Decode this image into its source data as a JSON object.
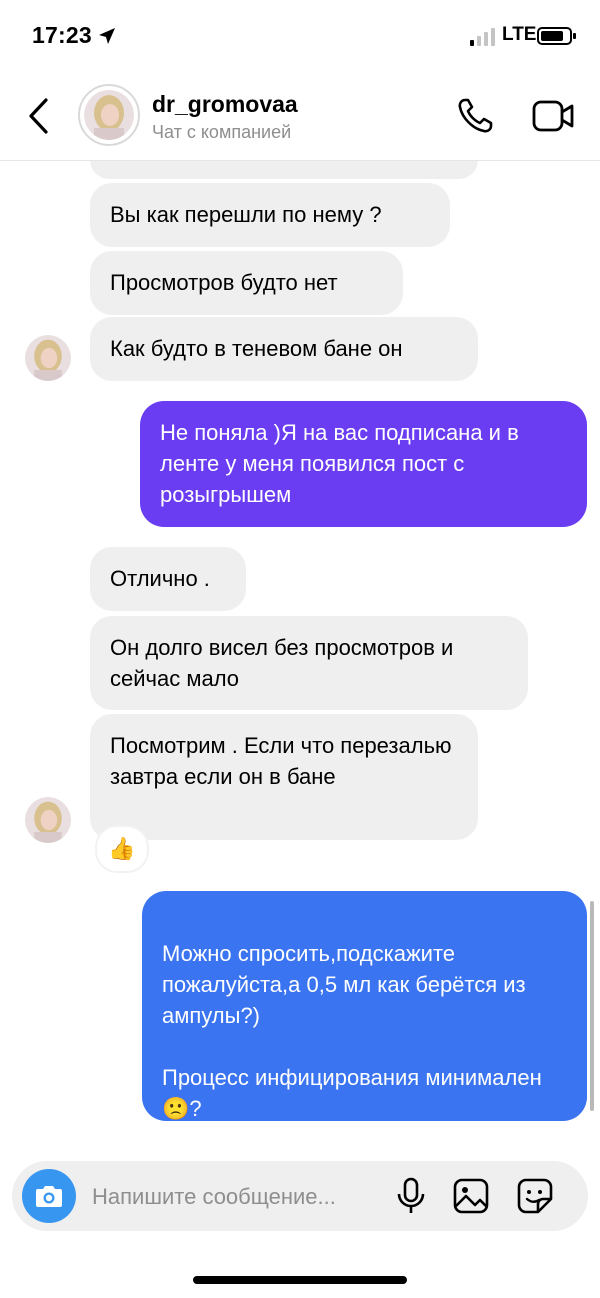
{
  "status_bar": {
    "time": "17:23",
    "network": "LTE"
  },
  "header": {
    "username": "dr_gromovaa",
    "subtitle": "Чат с компанией"
  },
  "messages": [
    {
      "dir": "in",
      "text": "Вы как перешли по нему ?"
    },
    {
      "dir": "in",
      "text": "Просмотров будто нет"
    },
    {
      "dir": "in",
      "text": "Как будто в теневом бане он"
    },
    {
      "dir": "out",
      "text": "Не поняла )Я на вас подписана и в ленте у меня появился пост с розыгрышем"
    },
    {
      "dir": "in",
      "text": "Отлично ."
    },
    {
      "dir": "in",
      "text": "Он долго висел без просмотров и сейчас мало"
    },
    {
      "dir": "in",
      "text": "Посмотрим . Если что перезалью завтра если он в бане",
      "reaction": "👍"
    },
    {
      "dir": "out",
      "text": "Можно спросить,подскажите пожалуйста,а 0,5 мл как берётся из ампулы?)\n\nПроцесс инфицирования минимален 🙁?"
    }
  ],
  "colors": {
    "out_bubble_1": "#6a3cf2",
    "out_bubble_2": "#3a74f0",
    "in_bubble": "#efefef",
    "camera": "#3797f0"
  },
  "composer": {
    "placeholder": "Напишите сообщение..."
  },
  "icons": [
    "location-arrow-icon",
    "signal-icon",
    "battery-icon",
    "back-icon",
    "phone-icon",
    "video-icon",
    "camera-icon",
    "microphone-icon",
    "gallery-icon",
    "sticker-icon",
    "thumbs-up-icon"
  ]
}
